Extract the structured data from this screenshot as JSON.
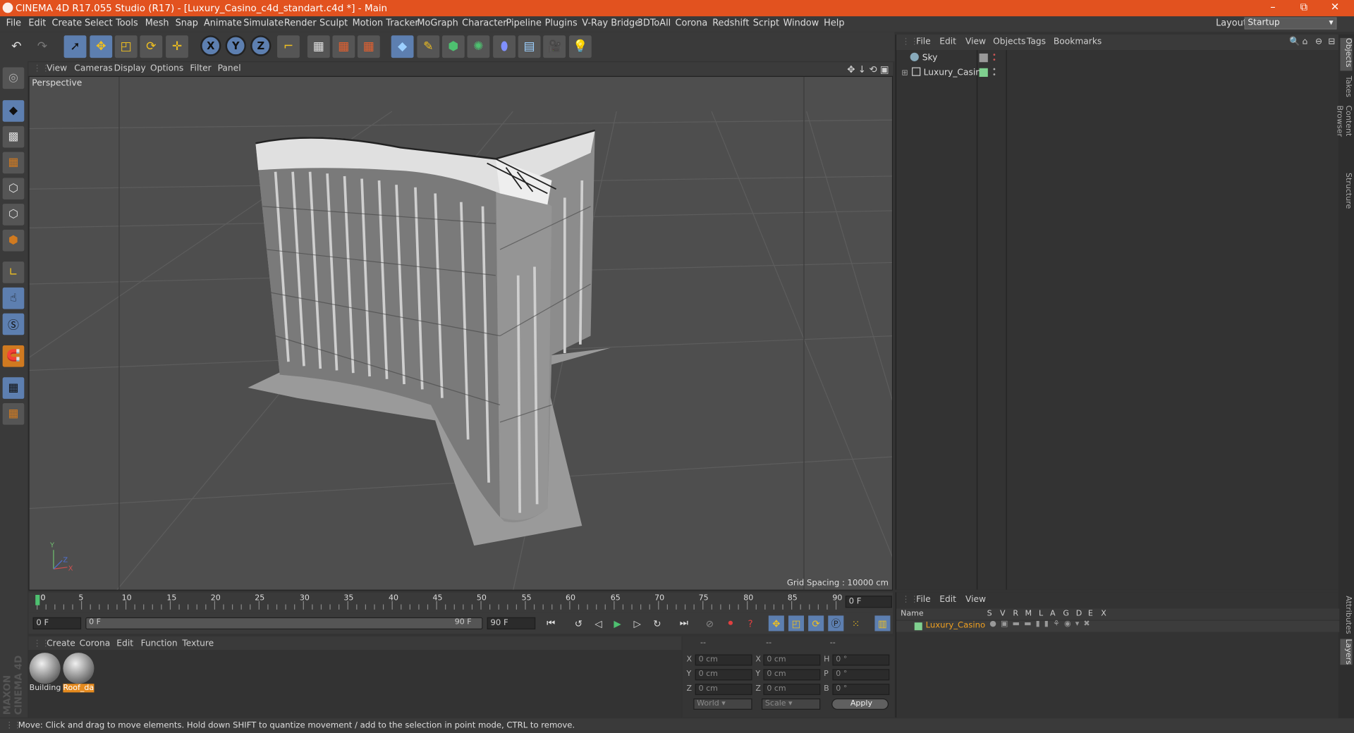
{
  "window": {
    "title": "CINEMA 4D R17.055 Studio (R17) - [Luxury_Casino_c4d_standart.c4d *] - Main",
    "controls": [
      "–",
      "⧉",
      "✕"
    ]
  },
  "menubar": {
    "items": [
      "File",
      "Edit",
      "Create",
      "Select",
      "Tools",
      "Mesh",
      "Snap",
      "Animate",
      "Simulate",
      "Render",
      "Sculpt",
      "Motion Tracker",
      "MoGraph",
      "Character",
      "Pipeline",
      "Plugins",
      "V-Ray Bridge",
      "3DToAll",
      "Corona",
      "Redshift",
      "Script",
      "Window",
      "Help"
    ],
    "layout_label": "Layout:",
    "layout_value": "Startup"
  },
  "viewport": {
    "menu": [
      "View",
      "Cameras",
      "Display",
      "Options",
      "Filter",
      "Panel"
    ],
    "label": "Perspective",
    "grid_spacing": "Grid Spacing : 10000 cm"
  },
  "objects": {
    "menu": [
      "File",
      "Edit",
      "View",
      "Objects",
      "Tags",
      "Bookmarks"
    ],
    "items": [
      {
        "name": "Sky"
      },
      {
        "name": "Luxury_Casino"
      }
    ]
  },
  "side_tabs": [
    "Objects",
    "Takes",
    "Content Browser",
    "Structure",
    "Attributes",
    "Layers"
  ],
  "timeline": {
    "ticks": [
      "0",
      "5",
      "10",
      "15",
      "20",
      "25",
      "30",
      "35",
      "40",
      "45",
      "50",
      "55",
      "60",
      "65",
      "70",
      "75",
      "80",
      "85",
      "90"
    ],
    "end_field": "0 F",
    "current": "0 F",
    "range_start": "0 F",
    "range_end": "90 F",
    "max": "90 F"
  },
  "materials": {
    "menu": [
      "Create",
      "Corona",
      "Edit",
      "Function",
      "Texture"
    ],
    "items": [
      "Building",
      "Roof_da"
    ]
  },
  "coords": {
    "headers": [
      "--",
      "--",
      "--"
    ],
    "rows": [
      {
        "a": "X",
        "av": "0 cm",
        "b": "X",
        "bv": "0 cm",
        "c": "H",
        "cv": "0 °"
      },
      {
        "a": "Y",
        "av": "0 cm",
        "b": "Y",
        "bv": "0 cm",
        "c": "P",
        "cv": "0 °"
      },
      {
        "a": "Z",
        "av": "0 cm",
        "b": "Z",
        "bv": "0 cm",
        "c": "B",
        "cv": "0 °"
      }
    ],
    "world": "World",
    "scale": "Scale",
    "apply": "Apply"
  },
  "layers": {
    "menu": [
      "File",
      "Edit",
      "View"
    ],
    "columns": [
      "Name",
      "S",
      "V",
      "R",
      "M",
      "L",
      "A",
      "G",
      "D",
      "E",
      "X"
    ],
    "rows": [
      {
        "name": "Luxury_Casino"
      }
    ]
  },
  "status": "Move: Click and drag to move elements. Hold down SHIFT to quantize movement / add to the selection in point mode, CTRL to remove.",
  "brand": "MAXON CINEMA 4D"
}
